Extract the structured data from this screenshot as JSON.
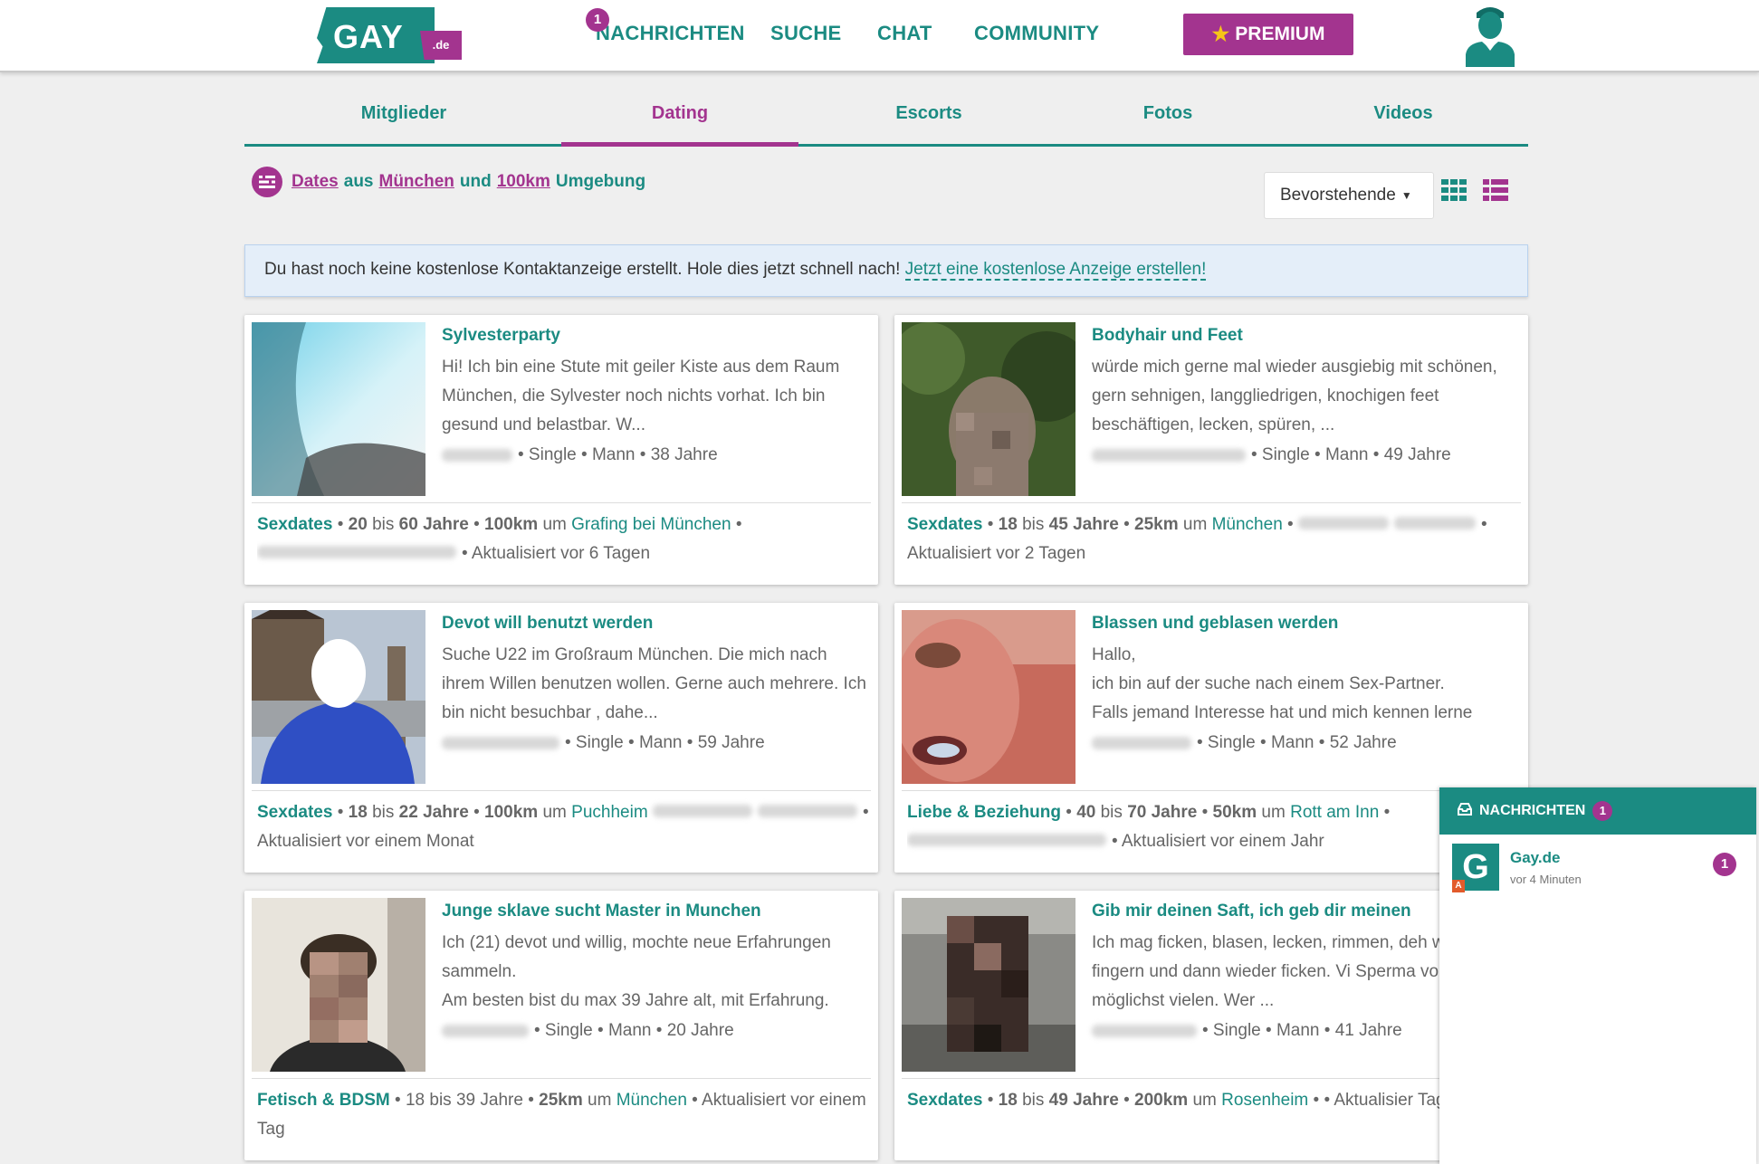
{
  "header": {
    "logo_text": "GAY",
    "logo_domain": ".de",
    "nav": [
      {
        "label": "NACHRICHTEN",
        "badge": "1"
      },
      {
        "label": "SUCHE"
      },
      {
        "label": "CHAT"
      },
      {
        "label": "COMMUNITY"
      }
    ],
    "premium_label": "PREMIUM",
    "premium_icon": "star-icon",
    "profile_icon": "user-avatar-icon"
  },
  "subnav": {
    "tabs": [
      "Mitglieder",
      "Dating",
      "Escorts",
      "Fotos",
      "Videos"
    ],
    "active": "Dating"
  },
  "filter": {
    "link_dates": "Dates",
    "word_aus": "aus",
    "link_city": "München",
    "word_und": "und",
    "link_radius": "100km",
    "word_umgebung": "Umgebung"
  },
  "sort": {
    "selected": "Bevorstehende"
  },
  "notice": {
    "text": "Du hast noch keine kostenlose Kontaktanzeige erstellt. Hole dies jetzt schnell nach! ",
    "link": "Jetzt eine kostenlose Anzeige erstellen!"
  },
  "cards": [
    {
      "title": "Sylvesterparty",
      "desc": "Hi! Ich bin eine Stute mit geiler Kiste aus dem Raum München, die Sylvester noch nichts vorhat. Ich bin gesund und belastbar. W...",
      "meta": "• Single • Mann • 38 Jahre",
      "category": "Sexdates",
      "age_from": "20",
      "age_to": "60",
      "radius": "100km",
      "word_um": "um",
      "place": "Grafing bei München",
      "updated": "• Aktualisiert vor 6 Tagen"
    },
    {
      "title": "Bodyhair und Feet",
      "desc": "würde mich gerne mal wieder ausgiebig mit schönen, gern sehnigen, langgliedrigen, knochigen feet beschäftigen, lecken, spüren, ...",
      "meta": "• Single • Mann • 49 Jahre",
      "category": "Sexdates",
      "age_from": "18",
      "age_to": "45",
      "radius": "25km",
      "word_um": "um",
      "place": "München",
      "updated": "• Aktualisiert vor 2 Tagen"
    },
    {
      "title": "Devot will benutzt werden",
      "desc": "Suche U22 im Großraum München. Die mich nach ihrem Willen benutzen wollen. Gerne auch mehrere. Ich bin nicht besuchbar , dahe...",
      "meta": "• Single • Mann • 59 Jahre",
      "category": "Sexdates",
      "age_from": "18",
      "age_to": "22",
      "radius": "100km",
      "word_um": "um",
      "place": "Puchheim",
      "updated": "• Aktualisiert vor einem Monat"
    },
    {
      "title": "Blassen und geblasen werden",
      "desc": "Hallo,\nich bin auf der suche nach einem Sex-Partner.\nFalls jemand Interesse hat und mich kennen lerne",
      "meta": "• Single • Mann • 52 Jahre",
      "category": "Liebe & Beziehung",
      "age_from": "40",
      "age_to": "70",
      "radius": "50km",
      "word_um": "um",
      "place": "Rott am Inn",
      "updated": "• Aktualisiert vor einem Jahr"
    },
    {
      "title": "Junge sklave sucht Master in Munchen",
      "desc": "Ich (21) devot und willig, mochte neue Erfahrungen sammeln.\nAm besten bist du max 39 Jahre alt, mit Erfahrung.",
      "meta": "• Single • Mann • 20 Jahre",
      "category": "Fetisch & BDSM",
      "age_from": "18",
      "age_to": "39",
      "radius": "25km",
      "word_um": "um",
      "place": "München",
      "updated": "• Aktualisiert vor einem Tag"
    },
    {
      "title": "Gib mir deinen Saft, ich geb dir meinen",
      "desc": "Ich mag ficken, blasen, lecken, rimmen, deh wichsen, fingern und dann wieder ficken. Vi Sperma von möglichst vielen. Wer ...",
      "meta": "• Single • Mann • 41 Jahre",
      "category": "Sexdates",
      "age_from": "18",
      "age_to": "49",
      "radius": "200km",
      "word_um": "um",
      "place": "Rosenheim",
      "updated": "• Aktualisier Tagen"
    }
  ],
  "messages": {
    "title": "NACHRICHTEN",
    "badge": "1",
    "item": {
      "logo": "G",
      "name": "Gay.de",
      "time": "vor 4 Minuten",
      "count": "1",
      "flag": "A"
    }
  },
  "colors": {
    "teal": "#1b8b82",
    "purple": "#a3348f",
    "background": "#efefef"
  }
}
